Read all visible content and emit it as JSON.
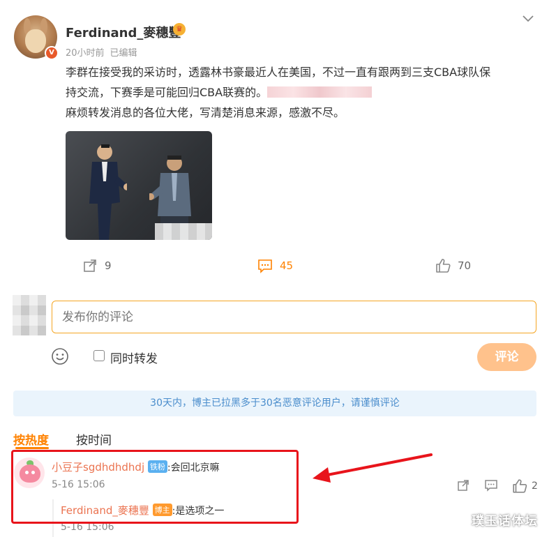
{
  "post": {
    "username": "Ferdinand_麥穗豐",
    "avatar_badge": "V",
    "time": "20小时前",
    "edited": "已编辑",
    "text_line1": "李群在接受我的采访时，透露林书豪最近人在美国，不过一直有跟两到三支CBA球队保",
    "text_line2": "持交流，下赛季是可能回归CBA联赛的。",
    "text_line3": "麻烦转发消息的各位大佬，写清楚消息来源，感激不尽。",
    "actions": {
      "repost_count": "9",
      "comment_count": "45",
      "like_count": "70"
    }
  },
  "composer": {
    "placeholder": "发布你的评论",
    "repost_label": "同时转发",
    "submit_label": "评论"
  },
  "notice": "30天内，博主已拉黑多于30名恶意评论用户，请谨慎评论",
  "sort_tabs": [
    "按热度",
    "按时间"
  ],
  "comment": {
    "name": "小豆子sgdhdhdhdj",
    "badge": "铁粉",
    "text": ":会回北京嘛",
    "time": "5-16 15:06",
    "like_count": "2",
    "reply": {
      "name": "Ferdinand_麥穗豐",
      "badge": "博主",
      "text": ":是选项之一",
      "time": "5-16 15:06"
    }
  },
  "watermark": "璞玉话体坛",
  "colors": {
    "accent": "#ff8200",
    "link_name": "#eb7350",
    "notice_text": "#4a8dcc",
    "highlight": "#e8141b"
  },
  "icons": [
    "crown-icon",
    "chevron-down-icon",
    "repost-icon",
    "comment-icon",
    "like-icon",
    "emoji-icon"
  ]
}
